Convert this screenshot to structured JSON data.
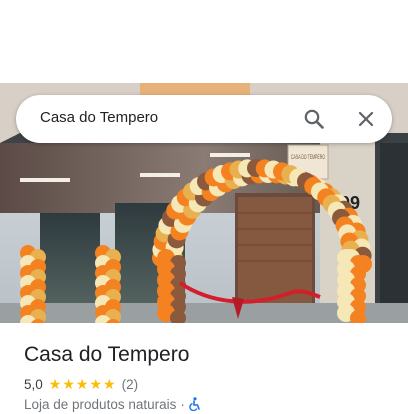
{
  "search": {
    "query": "Casa do Tempero"
  },
  "photo": {
    "storefront_number": "709",
    "sign_text": "CASA DO TEMPERO"
  },
  "place": {
    "name": "Casa do Tempero",
    "rating": "5,0",
    "stars": 5,
    "review_count": "(2)",
    "category": "Loja de produtos naturais",
    "separator": "·"
  },
  "colors": {
    "star": "#fbbc04",
    "accessibility": "#1a73e8",
    "balloon_orange": "#f58220",
    "balloon_cream": "#f6e7b6",
    "ribbon": "#d21f2b"
  },
  "icons": {
    "search": "search-icon",
    "close": "close-icon",
    "accessibility": "wheelchair-icon"
  }
}
